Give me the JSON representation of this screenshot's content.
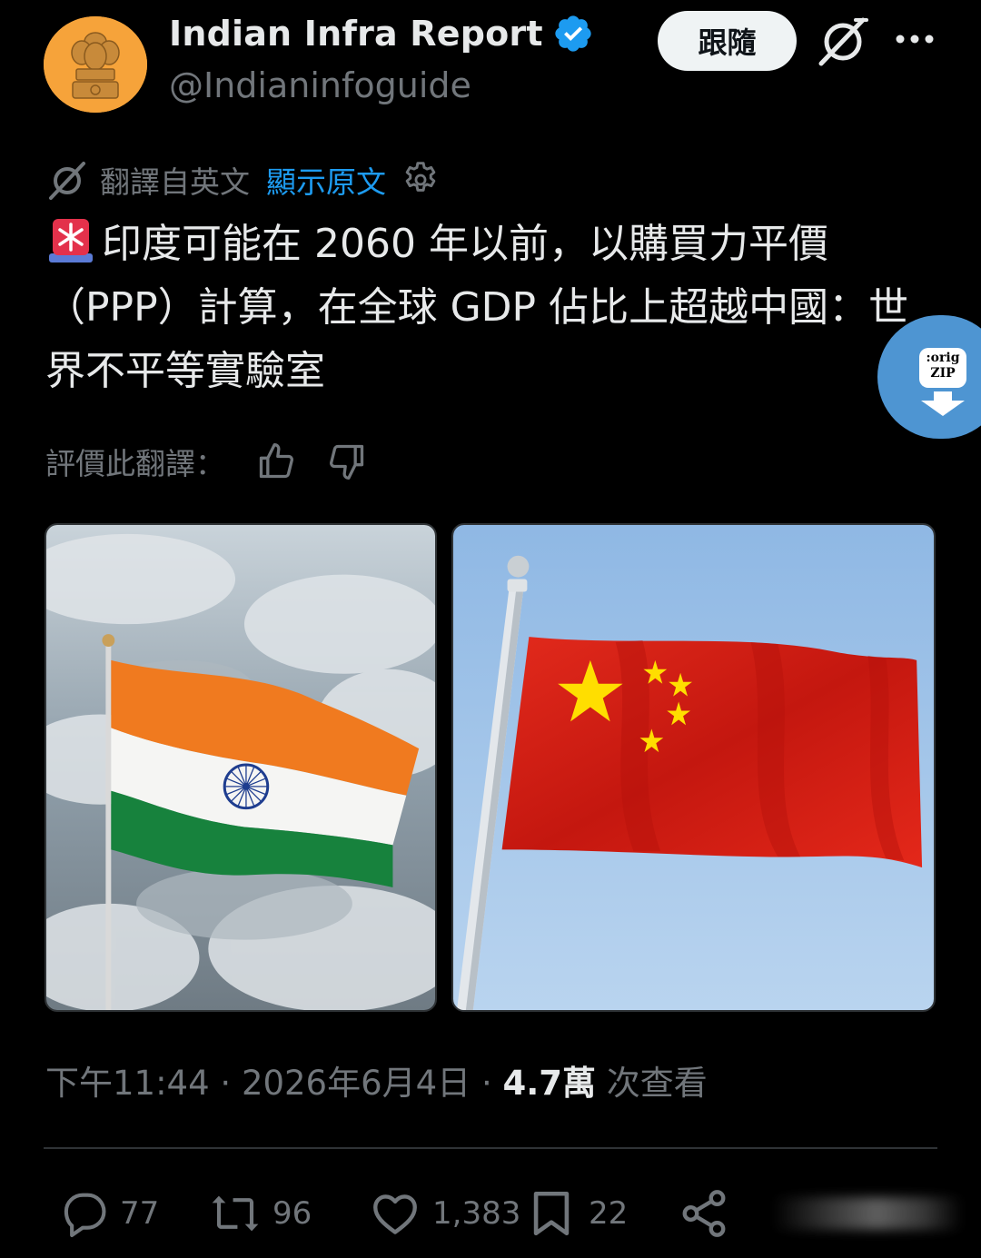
{
  "author": {
    "display_name": "Indian Infra Report",
    "handle": "@Indianinfoguide",
    "verified": true,
    "avatar_color": "#f6a33a"
  },
  "header": {
    "follow_label": "跟隨",
    "grok_icon": "grok-icon",
    "more_icon": "more-icon"
  },
  "translation": {
    "label": "翻譯自英文",
    "show_original": "顯示原文",
    "icon": "translate-icon",
    "settings_icon": "gear-icon"
  },
  "tweet": {
    "emoji": "siren-emoji",
    "text": "印度可能在 2060 年以前，以購買力平價（PPP）計算，在全球 GDP 佔比上超越中國：世界不平等實驗室"
  },
  "side_button": {
    "label_line1": ":orig",
    "label_line2": "ZIP",
    "color": "#4e95d2"
  },
  "rate": {
    "label": "評價此翻譯：",
    "thumbs_up_icon": "thumbs-up-icon",
    "thumbs_down_icon": "thumbs-down-icon"
  },
  "media": [
    {
      "subject": "india-flag-image"
    },
    {
      "subject": "china-flag-image"
    }
  ],
  "meta": {
    "time": "下午11:44",
    "separator1": " · ",
    "date": "2026年6月4日",
    "separator2": " · ",
    "views_count": "4.7萬",
    "views_label": " 次查看"
  },
  "actions": {
    "replies": "77",
    "reposts": "96",
    "likes": "1,383",
    "bookmarks": "22"
  },
  "colors": {
    "accent": "#1d9bf0",
    "text_primary": "#e7e9ea",
    "text_secondary": "#71767b",
    "background": "#000000",
    "divider": "#2f3336"
  }
}
